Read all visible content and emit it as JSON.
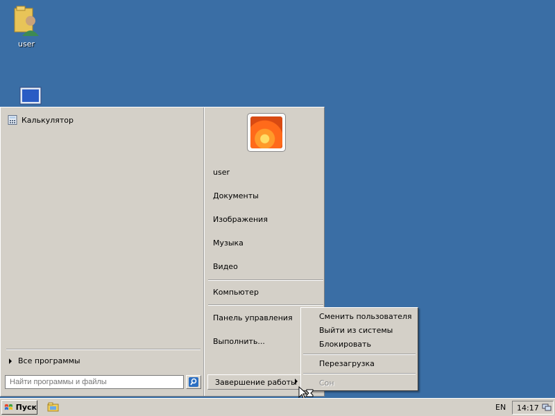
{
  "desktop": {
    "icons": [
      {
        "label": "user",
        "icon": "user-folder-icon"
      },
      {
        "label": "",
        "icon": "computer-icon"
      }
    ]
  },
  "start_menu": {
    "programs": [
      {
        "label": "Калькулятор",
        "icon": "calculator-icon"
      }
    ],
    "all_programs": "Все программы",
    "search_placeholder": "Найти программы и файлы",
    "right": {
      "user": "user",
      "documents": "Документы",
      "pictures": "Изображения",
      "music": "Музыка",
      "video": "Видео",
      "computer": "Компьютер",
      "control_panel": "Панель управления",
      "run": "Выполнить..."
    },
    "shutdown_label": "Завершение работы"
  },
  "shutdown_submenu": {
    "switch_user": "Сменить пользователя",
    "logoff": "Выйти из системы",
    "lock": "Блокировать",
    "restart": "Перезагрузка",
    "sleep": "Сон"
  },
  "taskbar": {
    "start_label": "Пуск",
    "language": "EN",
    "clock": "14:17"
  }
}
